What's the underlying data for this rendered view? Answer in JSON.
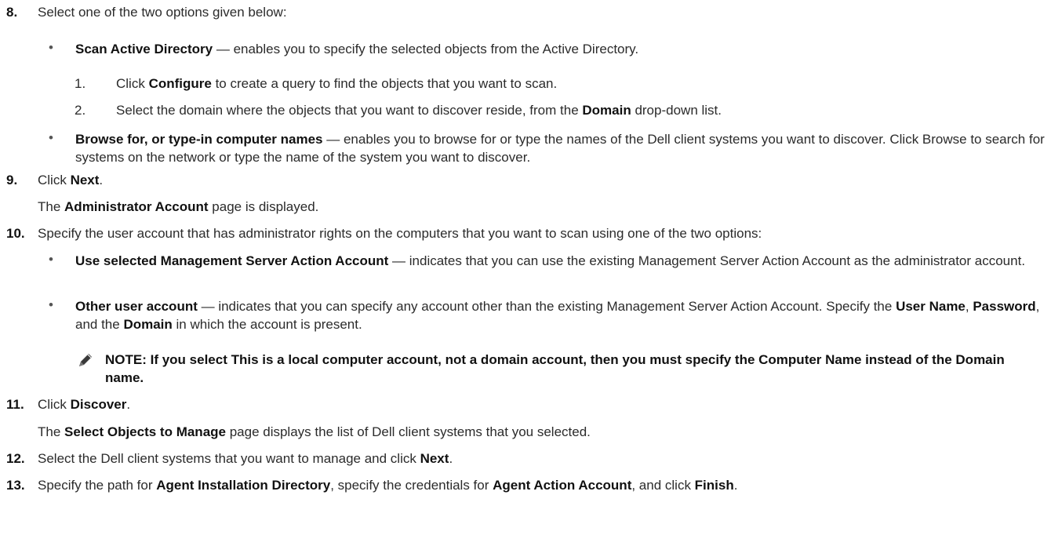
{
  "steps": {
    "s8": {
      "num": "8.",
      "text": "Select one of the two options given below:",
      "opt1": {
        "label": "Scan Active Directory",
        "desc": " — enables you to specify the selected objects from the Active Directory.",
        "sub1": {
          "num": "1.",
          "a": "Click ",
          "b": "Configure",
          "c": " to create a query to find the objects that you want to scan."
        },
        "sub2": {
          "num": "2.",
          "a": "Select the domain where the objects that you want to discover reside, from the ",
          "b": "Domain",
          "c": " drop-down list."
        }
      },
      "opt2": {
        "label": "Browse for, or type-in computer names",
        "desc": " — enables you to browse for or type the names of the Dell client systems you want to discover. Click Browse to search for systems on the network or type the name of the system you want to discover."
      }
    },
    "s9": {
      "num": "9.",
      "a": "Click ",
      "b": "Next",
      "c": ".",
      "result": {
        "a": "The ",
        "b": "Administrator Account",
        "c": " page is displayed."
      }
    },
    "s10": {
      "num": "10.",
      "text": "Specify the user account that has administrator rights on the computers that you want to scan using one of the two options:",
      "opt1": {
        "label": "Use selected Management Server Action Account",
        "desc": " — indicates that you can use the existing Management Server Action Account as the administrator account."
      },
      "opt2": {
        "label": "Other user account",
        "desc1": " — indicates that you can specify any account other than the existing Management Server Action Account. Specify the ",
        "user": "User Name",
        "sep1": ", ",
        "pass": "Password",
        "sep2": ", and the ",
        "domain": "Domain",
        "desc2": " in which the account is present."
      },
      "note": "NOTE: If you select This is a local computer account, not a domain account, then you must specify the Computer Name instead of the Domain name."
    },
    "s11": {
      "num": "11.",
      "a": "Click ",
      "b": "Discover",
      "c": ".",
      "result": {
        "a": "The ",
        "b": "Select Objects to Manage",
        "c": " page displays the list of Dell client systems that you selected."
      }
    },
    "s12": {
      "num": "12.",
      "a": "Select the Dell client systems that you want to manage and click ",
      "b": "Next",
      "c": "."
    },
    "s13": {
      "num": "13.",
      "a": "Specify the path for ",
      "b": "Agent Installation Directory",
      "c": ", specify the credentials for ",
      "d": "Agent Action Account",
      "e": ", and click ",
      "f": "Finish",
      "g": "."
    }
  },
  "bullet": "•",
  "icons": {
    "note": "pencil-note-icon"
  }
}
